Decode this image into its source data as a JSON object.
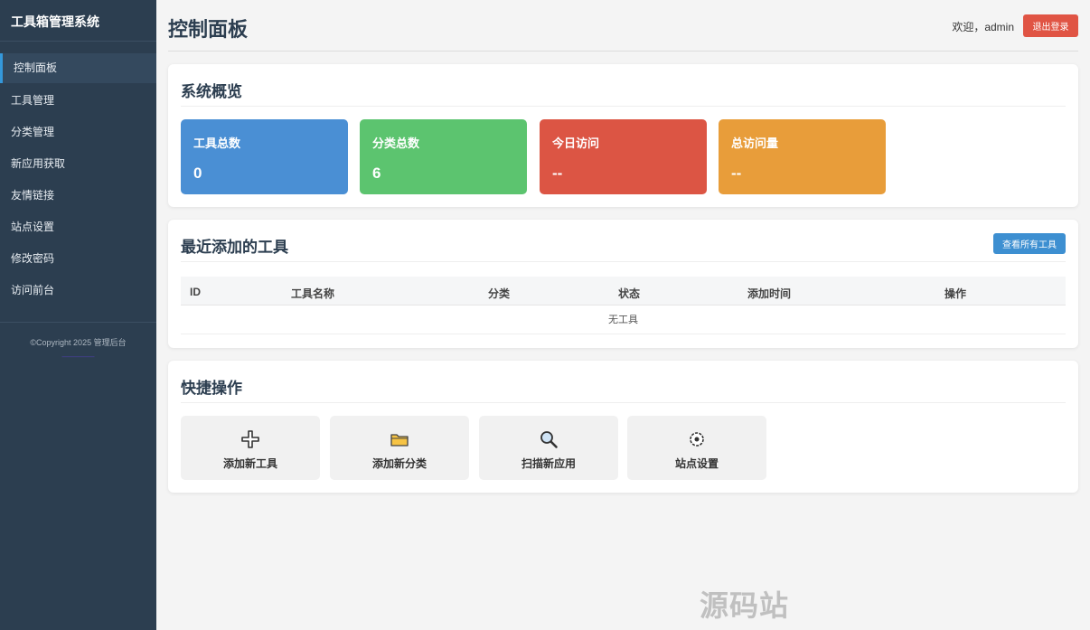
{
  "sidebar": {
    "brand": "工具箱管理系统",
    "items": [
      {
        "label": "控制面板"
      },
      {
        "label": "工具管理"
      },
      {
        "label": "分类管理"
      },
      {
        "label": "新应用获取"
      },
      {
        "label": "友情链接"
      },
      {
        "label": "站点设置"
      },
      {
        "label": "修改密码"
      },
      {
        "label": "访问前台"
      }
    ],
    "copyright": "©Copyright 2025 管理后台"
  },
  "header": {
    "title": "控制面板",
    "welcome": "欢迎，admin",
    "logout_label": "退出登录"
  },
  "overview": {
    "title": "系统概览",
    "stats": [
      {
        "label": "工具总数",
        "value": "0",
        "color": "#4a8fd4"
      },
      {
        "label": "分类总数",
        "value": "6",
        "color": "#5cc46f"
      },
      {
        "label": "今日访问",
        "value": "--",
        "color": "#dc5544"
      },
      {
        "label": "总访问量",
        "value": "--",
        "color": "#e89d3a"
      }
    ]
  },
  "recent": {
    "title": "最近添加的工具",
    "view_all_label": "查看所有工具",
    "columns": [
      "ID",
      "工具名称",
      "分类",
      "状态",
      "添加时间",
      "操作"
    ],
    "empty_text": "无工具"
  },
  "quick": {
    "title": "快捷操作",
    "actions": [
      {
        "label": "添加新工具",
        "icon": "plus-icon"
      },
      {
        "label": "添加新分类",
        "icon": "folder-icon"
      },
      {
        "label": "扫描新应用",
        "icon": "search-icon"
      },
      {
        "label": "站点设置",
        "icon": "gear-icon"
      }
    ]
  },
  "watermark": "源码站www.yuanmaz.com"
}
